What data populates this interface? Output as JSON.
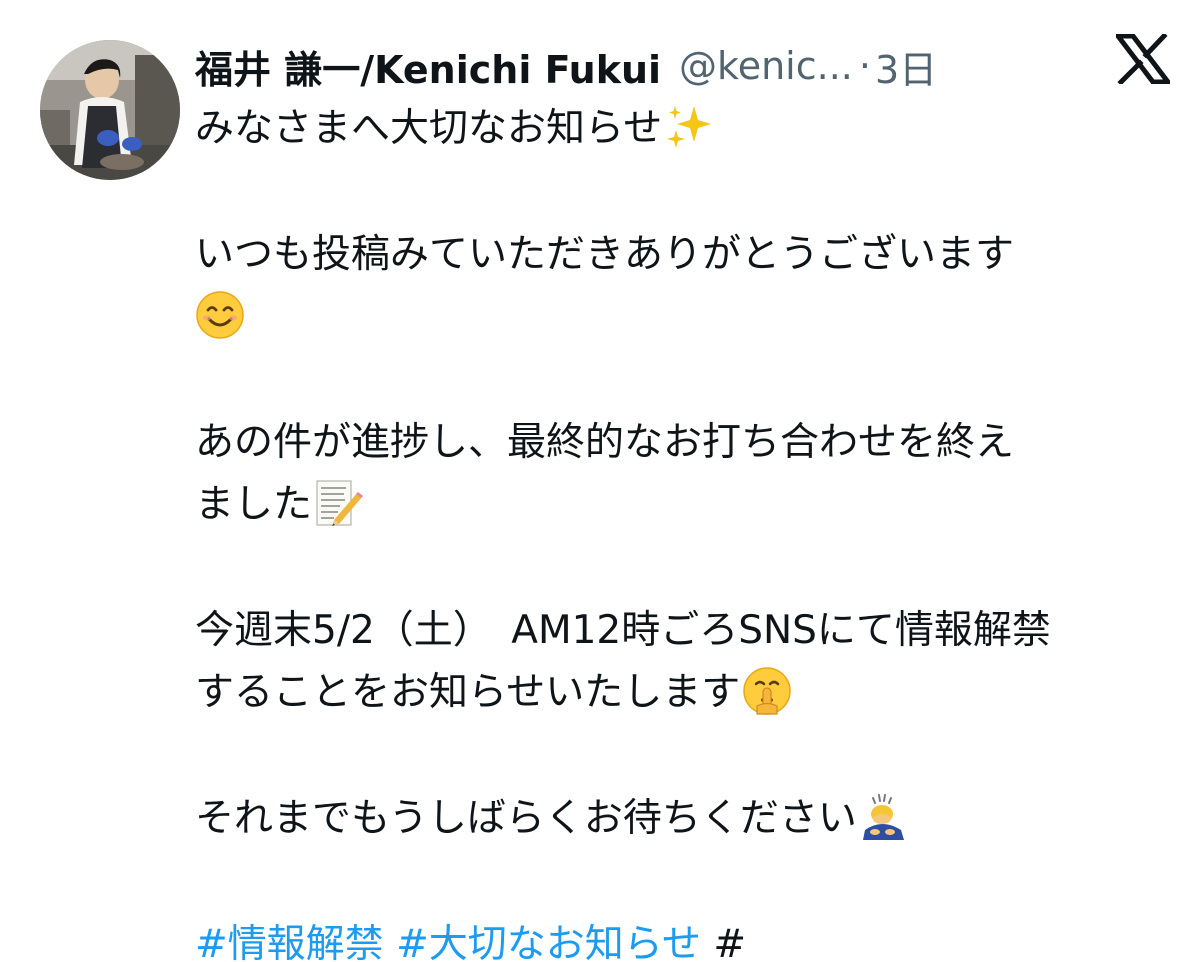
{
  "post": {
    "display_name": "福井 謙一/Kenichi Fukui",
    "handle": "@kenic...",
    "separator": "·",
    "time": "3日",
    "lines": {
      "l1": "みなさまへ大切なお知らせ",
      "l2": "いつも投稿みていただきありがとうございます",
      "l3": "あの件が進捗し、最終的なお打ち合わせを終え",
      "l4": "ました",
      "l5": "今週末5/2（土）　AM12時ごろSNSにて情報解禁",
      "l6": "することをお知らせいたします",
      "l7": "それまでもうしばらくお待ちください"
    },
    "hashtags": [
      "#情報解禁",
      "#大切なお知らせ"
    ],
    "trailing_hash": "#",
    "emojis": [
      "sparkles-emoji",
      "smiling-face-emoji",
      "memo-emoji",
      "shushing-face-emoji",
      "bowing-person-emoji"
    ]
  },
  "colors": {
    "text": "#0f1419",
    "secondary": "#536471",
    "link": "#1d9bf0",
    "background": "#ffffff"
  },
  "icons": [
    "x-logo-icon",
    "avatar"
  ]
}
